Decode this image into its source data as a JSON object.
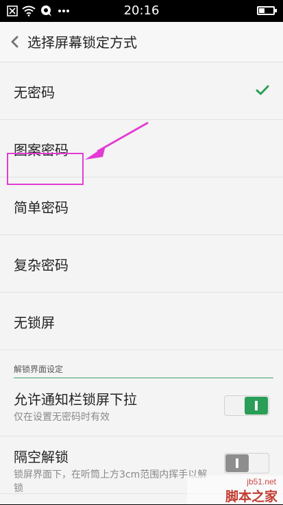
{
  "status_bar": {
    "time": "20:16",
    "icons": [
      "sim-off-icon",
      "wifi-icon",
      "chat-icon",
      "more-dots-icon",
      "battery-icon"
    ],
    "battery_level_percent": 35
  },
  "header": {
    "title": "选择屏幕锁定方式"
  },
  "lock_options": [
    {
      "label": "无密码",
      "selected": true
    },
    {
      "label": "图案密码",
      "selected": false
    },
    {
      "label": "简单密码",
      "selected": false
    },
    {
      "label": "复杂密码",
      "selected": false
    },
    {
      "label": "无锁屏",
      "selected": false
    }
  ],
  "section": {
    "label": "解锁界面设定"
  },
  "settings": [
    {
      "title": "允许通知栏锁屏下拉",
      "desc": "仅在设置无密码时有效",
      "enabled": true
    },
    {
      "title": "隔空解锁",
      "desc": "锁屏界面下，在听筒上方3cm范围内挥手以解锁",
      "enabled": false
    }
  ],
  "annotation": {
    "highlight_color": "#e33bd4"
  },
  "watermark": {
    "site": "jb51.net",
    "name": "脚本之家"
  },
  "colors": {
    "accent_green": "#2a9e57",
    "background": "#f4f4f4"
  }
}
